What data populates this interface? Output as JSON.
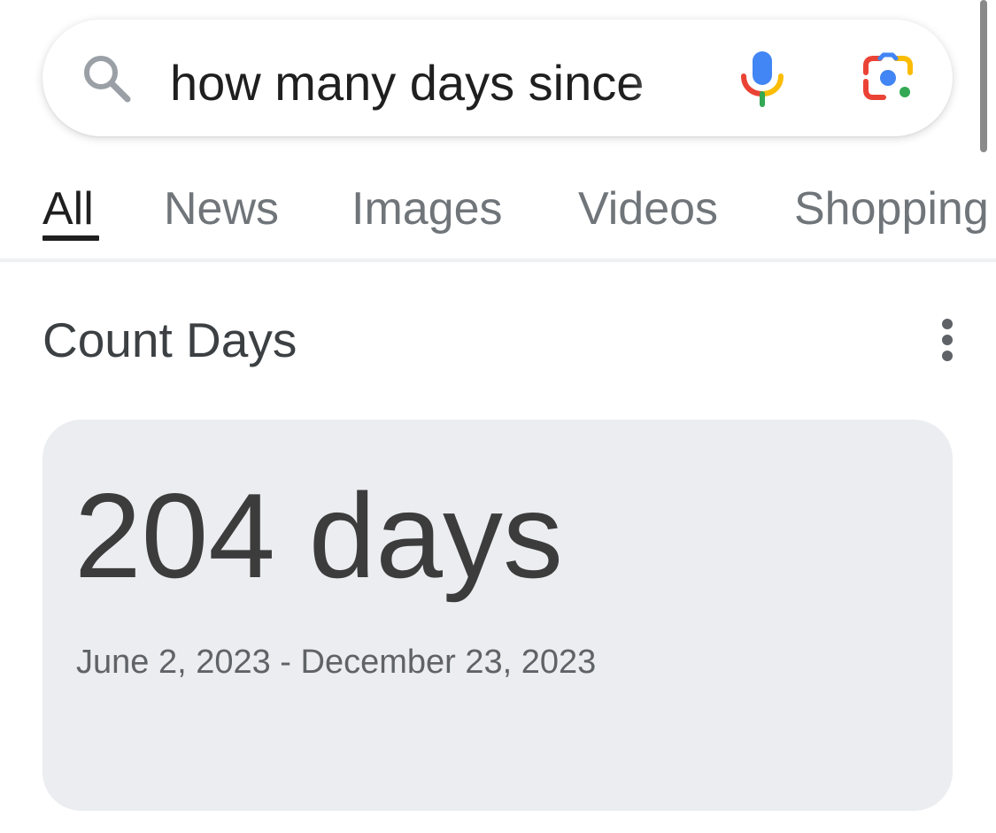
{
  "search": {
    "query": "how many days since",
    "icon": "search-icon",
    "voice_icon": "mic-icon",
    "lens_icon": "lens-icon"
  },
  "tabs": [
    {
      "label": "All",
      "active": true
    },
    {
      "label": "News",
      "active": false
    },
    {
      "label": "Images",
      "active": false
    },
    {
      "label": "Videos",
      "active": false
    },
    {
      "label": "Shopping",
      "active": false
    }
  ],
  "result": {
    "title": "Count Days",
    "value": "204 days",
    "date_range": "June 2, 2023 - December 23, 2023",
    "menu_icon": "more-vert-icon"
  },
  "colors": {
    "google_blue": "#4285F4",
    "google_red": "#EA4335",
    "google_yellow": "#FBBC04",
    "google_green": "#34A853",
    "card_background": "#EBEDF0"
  }
}
